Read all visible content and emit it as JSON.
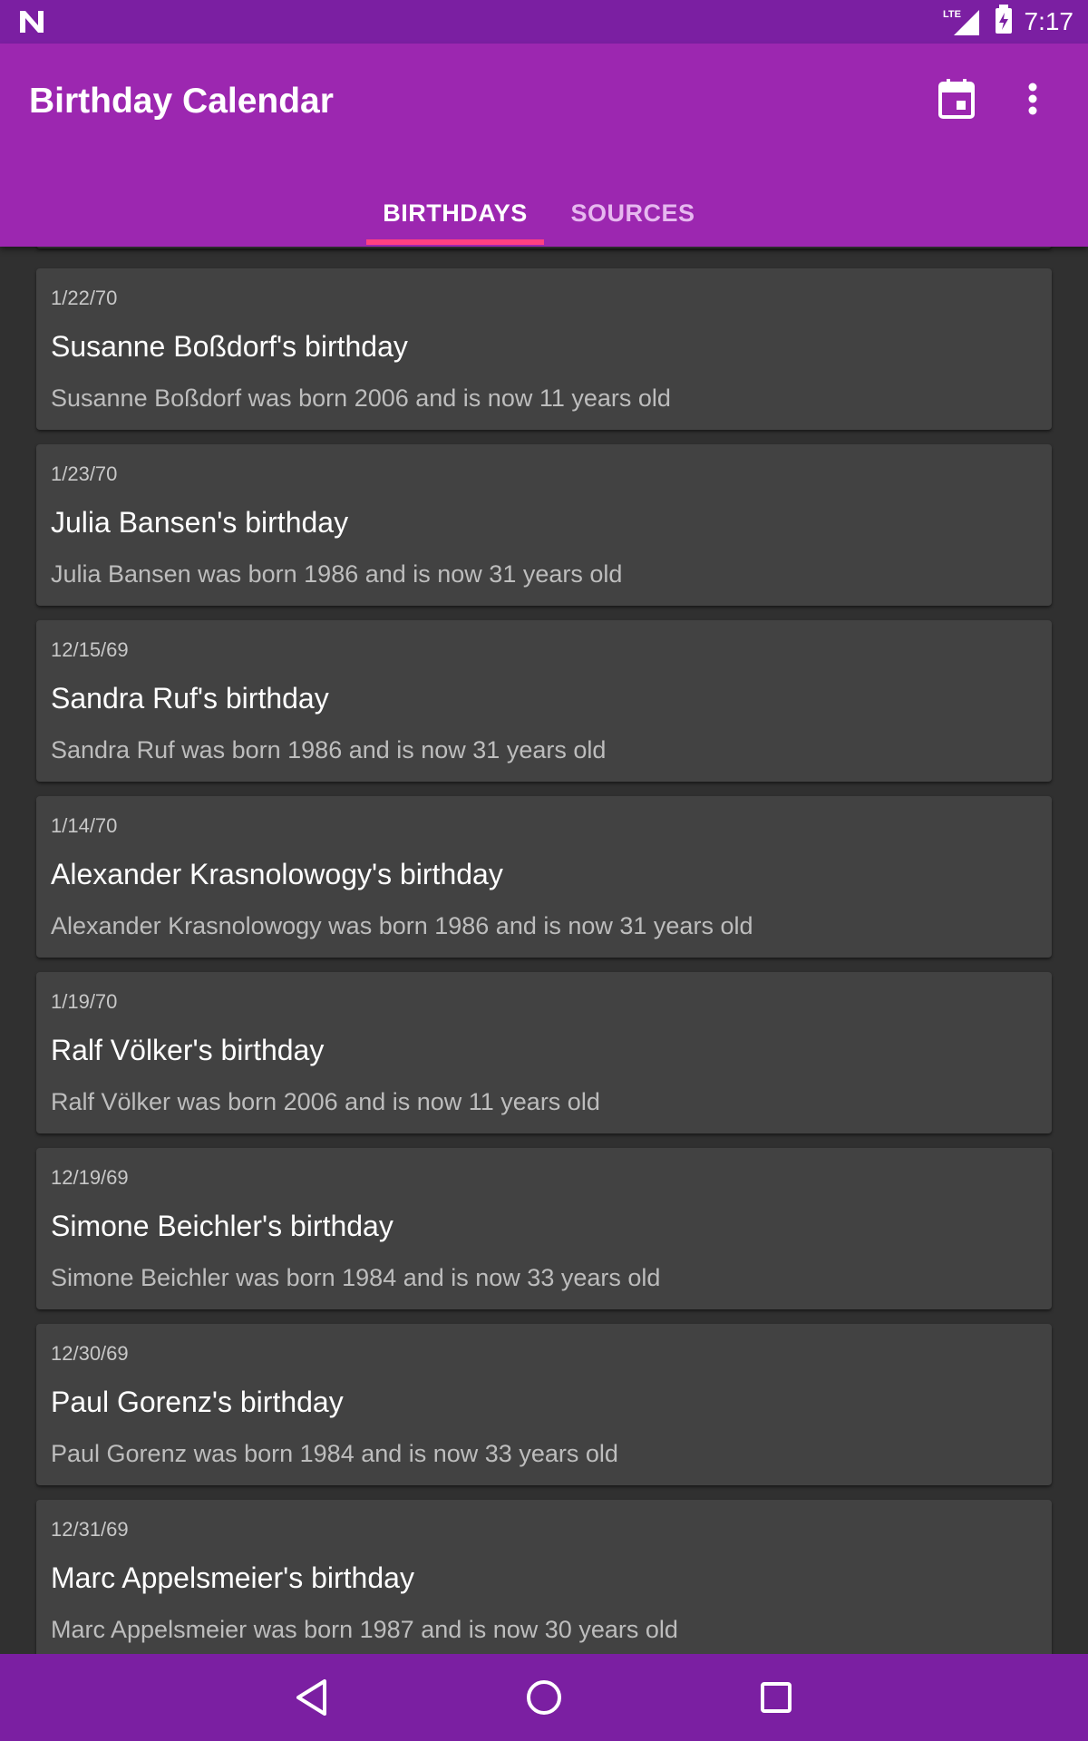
{
  "status_bar": {
    "time": "7:17",
    "network": "LTE"
  },
  "app_bar": {
    "title": "Birthday Calendar",
    "icons": [
      "calendar-icon",
      "more-vert-icon"
    ]
  },
  "tabs": [
    {
      "label": "BIRTHDAYS",
      "selected": true
    },
    {
      "label": "SOURCES",
      "selected": false
    }
  ],
  "colors": {
    "status_bar": "#7b1fa2",
    "app_bar": "#9c27b0",
    "tab_indicator": "#ff4081",
    "background": "#303030",
    "card": "#424242"
  },
  "events": [
    {
      "date": "1/22/70",
      "title": "Susanne Boßdorf's birthday",
      "description": "Susanne Boßdorf was born 2006 and is now 11 years old"
    },
    {
      "date": "1/23/70",
      "title": "Julia Bansen's birthday",
      "description": "Julia Bansen was born 1986 and is now 31 years old"
    },
    {
      "date": "12/15/69",
      "title": "Sandra Ruf's birthday",
      "description": "Sandra Ruf was born 1986 and is now 31 years old"
    },
    {
      "date": "1/14/70",
      "title": "Alexander Krasnolowogy's birthday",
      "description": "Alexander Krasnolowogy was born 1986 and is now 31 years old"
    },
    {
      "date": "1/19/70",
      "title": "Ralf Völker's birthday",
      "description": "Ralf Völker was born 2006 and is now 11 years old"
    },
    {
      "date": "12/19/69",
      "title": "Simone Beichler's birthday",
      "description": "Simone Beichler was born 1984 and is now 33 years old"
    },
    {
      "date": "12/30/69",
      "title": "Paul Gorenz's birthday",
      "description": "Paul Gorenz was born 1984 and is now 33 years old"
    },
    {
      "date": "12/31/69",
      "title": "Marc Appelsmeier's birthday",
      "description": "Marc Appelsmeier was born 1987 and is now 30 years old"
    }
  ],
  "nav_bar": {
    "icons": [
      "back-icon",
      "home-icon",
      "recents-icon"
    ]
  }
}
